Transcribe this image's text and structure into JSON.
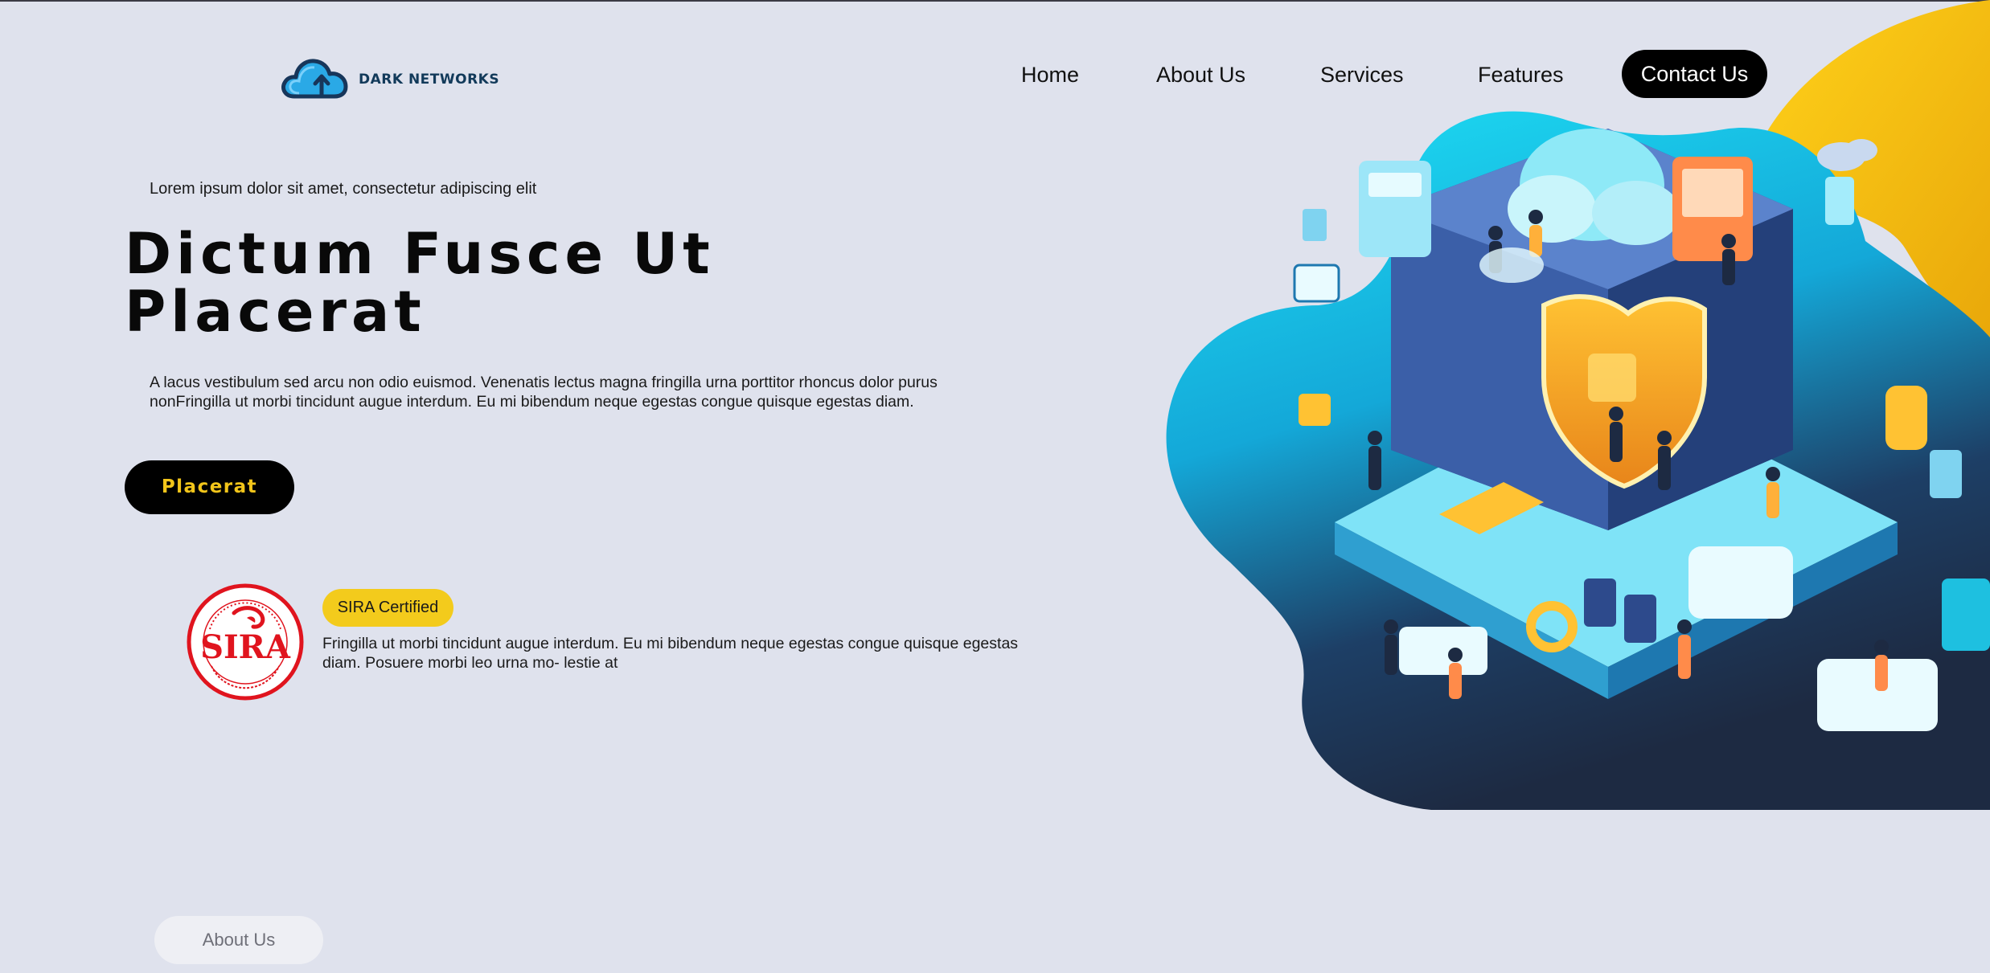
{
  "brand": {
    "name": "DARK NETWORKS",
    "logo_icon": "cloud-upload-icon"
  },
  "nav": {
    "items": [
      {
        "label": "Home"
      },
      {
        "label": "About Us"
      },
      {
        "label": "Services"
      },
      {
        "label": "Features"
      }
    ],
    "cta_label": "Contact Us"
  },
  "hero": {
    "eyebrow": "Lorem ipsum dolor sit amet, consectetur adipiscing elit",
    "title_line1": "Dictum Fusce Ut",
    "title_line2": "Placerat",
    "description": "A lacus vestibulum sed arcu non odio euismod. Venenatis lectus magna fringilla urna porttitor rhoncus dolor purus nonFringilla ut morbi tincidunt augue interdum. Eu mi bibendum neque egestas congue quisque egestas diam.",
    "button_label": "Placerat"
  },
  "certification": {
    "seal": "SIRA",
    "badge_label": "SIRA Certified",
    "description": "Fringilla ut morbi tincidunt augue interdum. Eu mi bibendum neque egestas congue quisque egestas diam. Posuere morbi leo urna mo- lestie at"
  },
  "section_pill": {
    "label": "About Us"
  },
  "colors": {
    "background": "#dfe2ed",
    "accent_yellow": "#f3cb1c",
    "button_black": "#000000",
    "blob_cyan": "#1ecdf0",
    "blob_navy": "#1f2a44",
    "seal_red": "#e0141e"
  }
}
